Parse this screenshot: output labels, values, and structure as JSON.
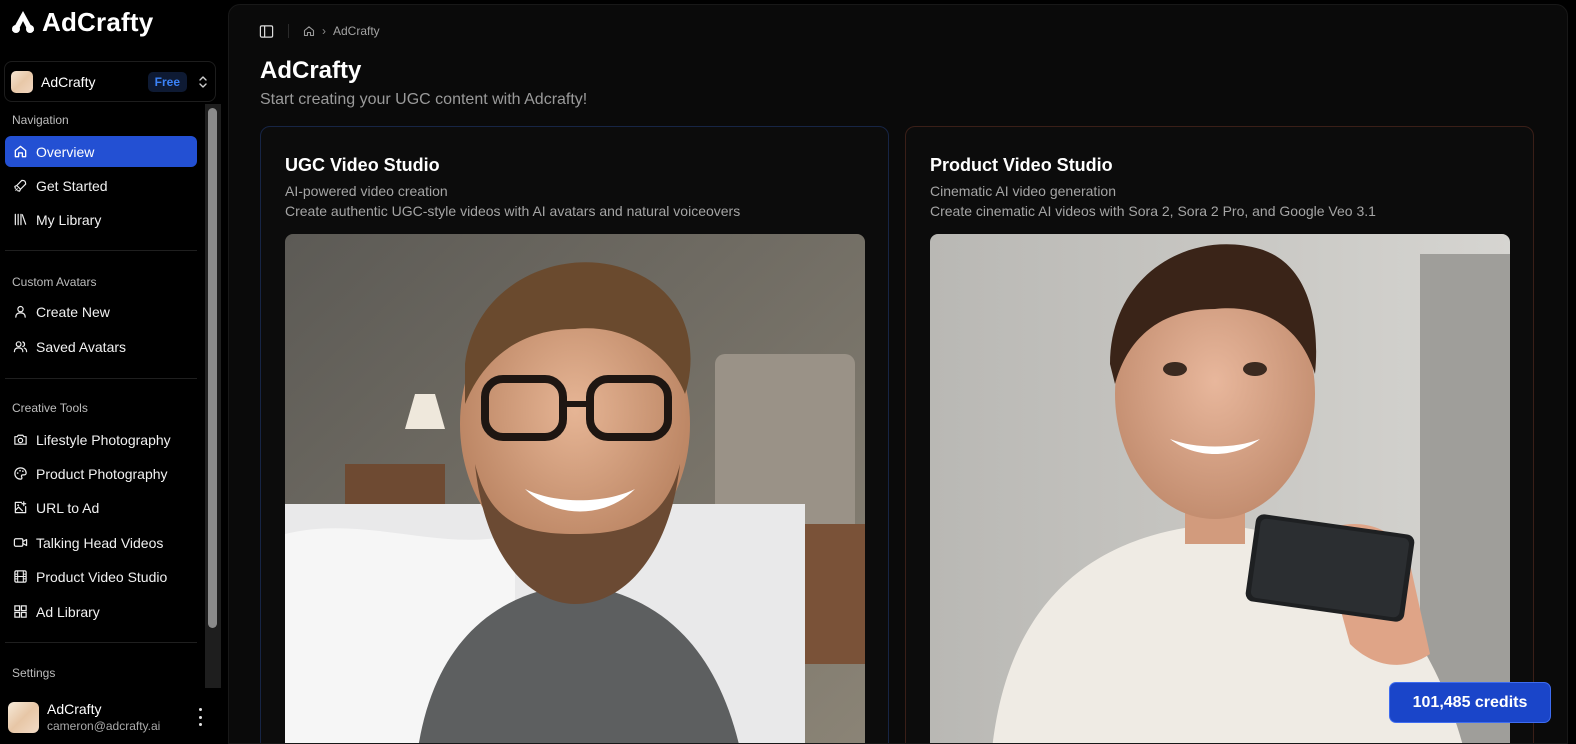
{
  "brand": {
    "name": "AdCrafty"
  },
  "team": {
    "name": "AdCrafty",
    "plan": "Free"
  },
  "sections": {
    "navigation": "Navigation",
    "custom_avatars": "Custom Avatars",
    "creative_tools": "Creative Tools",
    "settings": "Settings"
  },
  "nav": [
    {
      "label": "Overview",
      "icon": "home-icon",
      "active": true
    },
    {
      "label": "Get Started",
      "icon": "rocket-icon"
    },
    {
      "label": "My Library",
      "icon": "library-icon"
    }
  ],
  "avatars": [
    {
      "label": "Create New",
      "icon": "user-icon"
    },
    {
      "label": "Saved Avatars",
      "icon": "users-icon"
    }
  ],
  "tools": [
    {
      "label": "Lifestyle Photography",
      "icon": "camera-icon"
    },
    {
      "label": "Product Photography",
      "icon": "palette-icon"
    },
    {
      "label": "URL to Ad",
      "icon": "image-plus-icon"
    },
    {
      "label": "Talking Head Videos",
      "icon": "video-icon"
    },
    {
      "label": "Product Video Studio",
      "icon": "film-icon"
    },
    {
      "label": "Ad Library",
      "icon": "grid-icon"
    }
  ],
  "user": {
    "name": "AdCrafty",
    "email": "cameron@adcrafty.ai"
  },
  "breadcrumb": {
    "current": "AdCrafty"
  },
  "page": {
    "title": "AdCrafty",
    "subtitle": "Start creating your UGC content with Adcrafty!"
  },
  "cards": [
    {
      "title": "UGC Video Studio",
      "tagline": "AI-powered video creation",
      "description": "Create authentic UGC-style videos with AI avatars and natural voiceovers"
    },
    {
      "title": "Product Video Studio",
      "tagline": "Cinematic AI video generation",
      "description": "Create cinematic AI videos with Sora 2, Sora 2 Pro, and Google Veo 3.1"
    }
  ],
  "credits": {
    "label": "101,485 credits"
  },
  "colors": {
    "accent": "#2350d3",
    "credits_bg": "#1a45c9",
    "plan_badge": "#3b82f6"
  }
}
